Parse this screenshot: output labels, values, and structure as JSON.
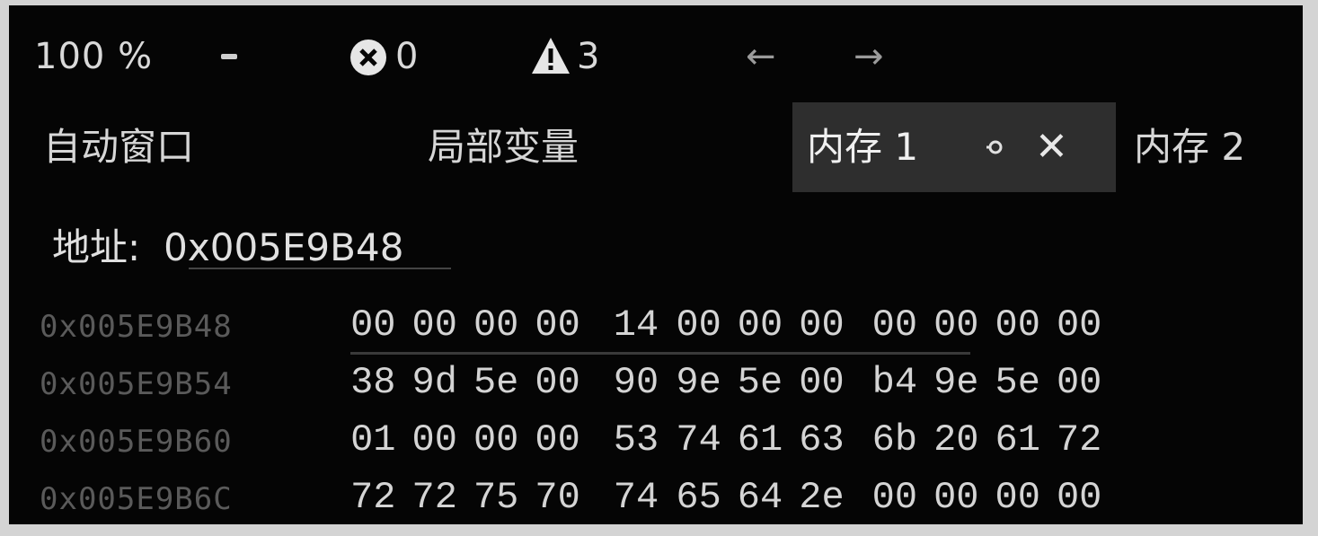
{
  "toolbar": {
    "zoom": "100 %",
    "error_count": "0",
    "warning_count": "3",
    "back_icon": "arrow-left-icon",
    "forward_icon": "arrow-right-icon"
  },
  "tabs": {
    "auto": "自动窗口",
    "locals": "局部变量",
    "memory1": "内存 1",
    "memory2": "内存 2"
  },
  "address": {
    "label": "地址:",
    "value": "0x005E9B48"
  },
  "memory": {
    "rows": [
      {
        "addr": "0x005E9B48",
        "bytes": [
          "00",
          "00",
          "00",
          "00",
          "14",
          "00",
          "00",
          "00",
          "00",
          "00",
          "00",
          "00"
        ]
      },
      {
        "addr": "0x005E9B54",
        "bytes": [
          "38",
          "9d",
          "5e",
          "00",
          "90",
          "9e",
          "5e",
          "00",
          "b4",
          "9e",
          "5e",
          "00"
        ]
      },
      {
        "addr": "0x005E9B60",
        "bytes": [
          "01",
          "00",
          "00",
          "00",
          "53",
          "74",
          "61",
          "63",
          "6b",
          "20",
          "61",
          "72"
        ]
      },
      {
        "addr": "0x005E9B6C",
        "bytes": [
          "72",
          "72",
          "75",
          "70",
          "74",
          "65",
          "64",
          "2e",
          "00",
          "00",
          "00",
          "00"
        ]
      }
    ]
  },
  "colors": {
    "background": "#050505",
    "active_tab": "#2e2e2e",
    "error": "#e0e0e0",
    "warning": "#e0e0e0"
  }
}
